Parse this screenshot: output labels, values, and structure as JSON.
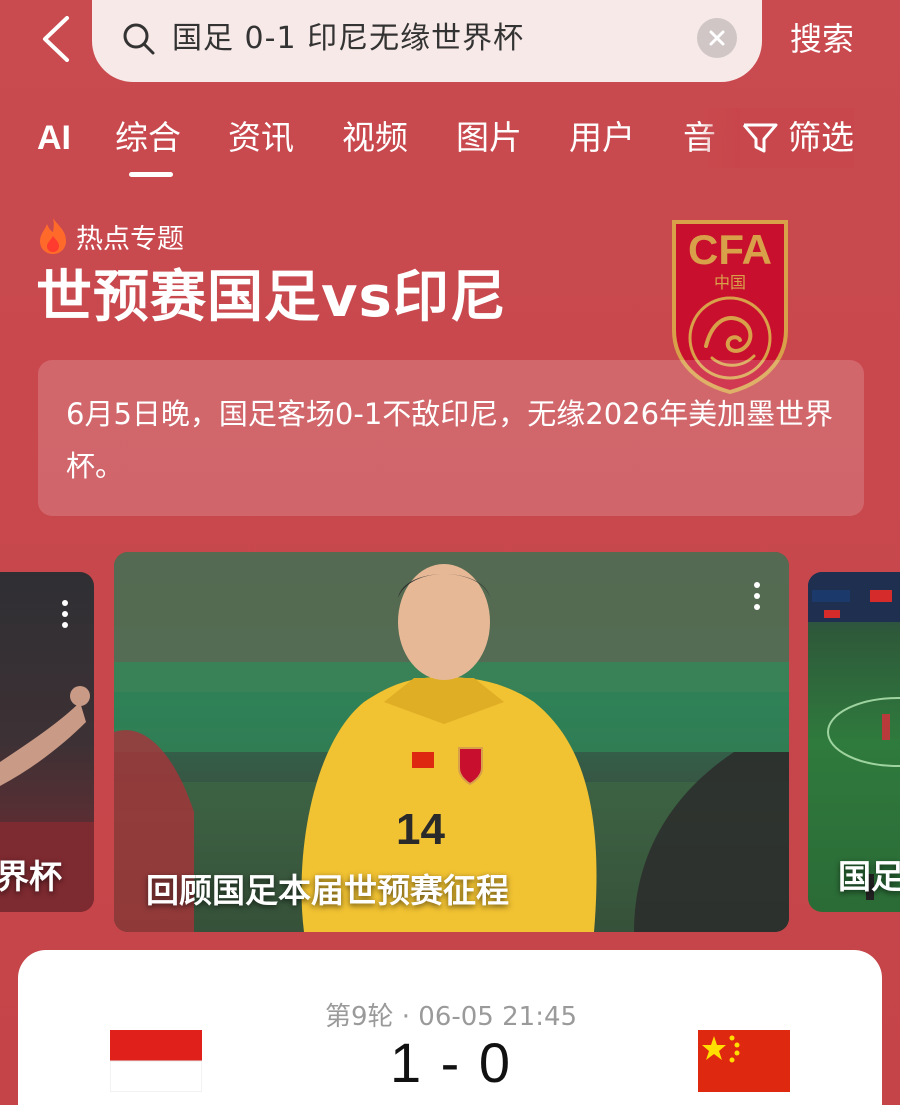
{
  "search": {
    "query": "国足 0-1 印尼无缘世界杯",
    "submit_label": "搜索"
  },
  "tabs": [
    {
      "label": "AI"
    },
    {
      "label": "综合"
    },
    {
      "label": "资讯"
    },
    {
      "label": "视频"
    },
    {
      "label": "图片"
    },
    {
      "label": "用户"
    },
    {
      "label": "音"
    }
  ],
  "active_tab": "综合",
  "filter_label": "筛选",
  "topic": {
    "tag": "热点专题",
    "title": "世预赛国足vs印尼",
    "logo_text": "CFA",
    "logo_subtext": "中国",
    "summary": "6月5日晚，国足客场0-1不敌印尼，无缘2026年美加墨世界杯。"
  },
  "carousel": {
    "left_caption": "界杯",
    "main_caption": "回顾国足本届世预赛征程",
    "right_caption": "国足"
  },
  "match": {
    "meta": "第9轮 · 06-05 21:45",
    "score": "1 - 0"
  },
  "colors": {
    "page_bg": "#c8474c",
    "search_bg": "#f7e9e7",
    "cfa_red": "#c8102e",
    "cfa_gold": "#d9a04a"
  }
}
